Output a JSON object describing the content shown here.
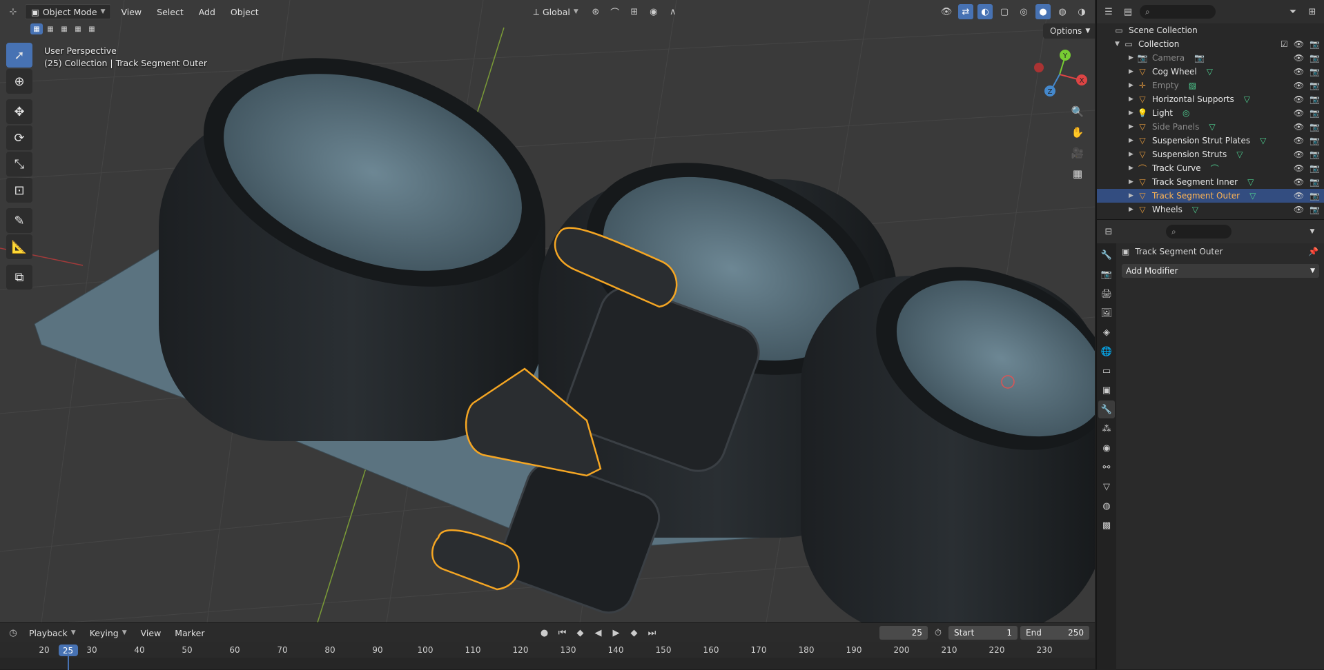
{
  "viewport_header": {
    "mode": "Object Mode",
    "menus": [
      "View",
      "Select",
      "Add",
      "Object"
    ],
    "transform_orientation": "Global",
    "options_label": "Options"
  },
  "viewport_overlay": {
    "view_name": "User Perspective",
    "collection_info": "(25) Collection | Track Segment Outer"
  },
  "gizmo": {
    "x_label": "X",
    "y_label": "Y",
    "z_label": "Z"
  },
  "outliner": {
    "root": "Scene Collection",
    "collection": "Collection",
    "items": [
      {
        "name": "Camera",
        "icon": "camera-icon",
        "dim": true
      },
      {
        "name": "Cog Wheel",
        "icon": "mesh-icon",
        "dim": false
      },
      {
        "name": "Empty",
        "icon": "empty-icon",
        "dim": true
      },
      {
        "name": "Horizontal Supports",
        "icon": "mesh-icon",
        "dim": false
      },
      {
        "name": "Light",
        "icon": "light-icon",
        "dim": false
      },
      {
        "name": "Side Panels",
        "icon": "mesh-icon",
        "dim": true
      },
      {
        "name": "Suspension Strut Plates",
        "icon": "mesh-icon",
        "dim": false
      },
      {
        "name": "Suspension Struts",
        "icon": "mesh-icon",
        "dim": false
      },
      {
        "name": "Track Curve",
        "icon": "curve-icon",
        "dim": false
      },
      {
        "name": "Track Segment Inner",
        "icon": "mesh-icon",
        "dim": false
      },
      {
        "name": "Track Segment Outer",
        "icon": "mesh-icon",
        "dim": false,
        "selected": true
      },
      {
        "name": "Wheels",
        "icon": "mesh-icon",
        "dim": false
      }
    ]
  },
  "properties": {
    "object_name": "Track Segment Outer",
    "add_modifier_label": "Add Modifier"
  },
  "timeline": {
    "menus": [
      "Playback",
      "Keying",
      "View",
      "Marker"
    ],
    "current_frame": "25",
    "start_label": "Start",
    "start_value": "1",
    "end_label": "End",
    "end_value": "250",
    "ruler_ticks": [
      "20",
      "30",
      "40",
      "50",
      "60",
      "70",
      "80",
      "90",
      "100",
      "110",
      "120",
      "130",
      "140",
      "150",
      "160",
      "170",
      "180",
      "190",
      "200",
      "210",
      "220",
      "230"
    ],
    "playhead_frame": "25"
  },
  "colors": {
    "accent": "#4772b3",
    "selection_outline": "#f5a623",
    "header_bg": "#2e2e2e"
  }
}
